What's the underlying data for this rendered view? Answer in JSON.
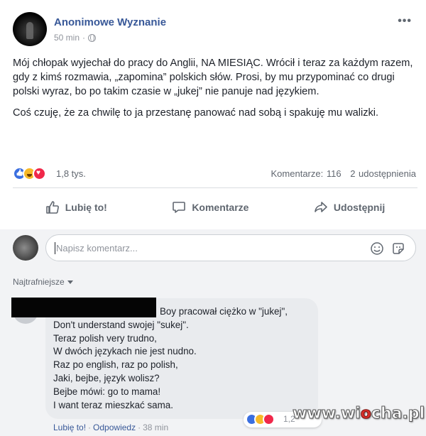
{
  "post": {
    "author": "Anonimowe Wyznanie",
    "time": "50 min",
    "privacy_icon": "globe-icon",
    "more_label": "•••",
    "paragraphs": [
      "Mój chłopak wyjechał do pracy do Anglii, NA MIESIĄC. Wrócił i teraz za każdym razem, gdy z kimś rozmawia, „zapomina” polskich słów. Prosi, by mu przypominać co drugi polski wyraz, bo po takim czasie w „jukej” nie panuje nad językiem.",
      "Coś czuję, że za chwilę to ja przestanę panować nad sobą i spakuję mu walizki."
    ]
  },
  "reactions": {
    "icons": [
      "like-icon",
      "haha-icon",
      "love-icon"
    ],
    "count": "1,8 tys.",
    "comments": "Komentarze: 116",
    "shares": "2 udostępnienia"
  },
  "actions": {
    "like": "Lubię to!",
    "comment": "Komentarze",
    "share": "Udostępnij"
  },
  "composer": {
    "placeholder": "Napisz komentarz..."
  },
  "sort": {
    "label": "Najtrafniejsze"
  },
  "comment": {
    "lines": [
      "Boy pracował ciężko w \"jukej\",",
      "Don't understand swojej \"sukej\".",
      "Teraz polish very trudno,",
      "W dwóch językach nie jest nudno.",
      "Raz po english, raz po polish,",
      "Jaki, bejbe, język wolisz?",
      "Bejbe mówi: go to mama!",
      "I want teraz mieszkać sama."
    ],
    "reaction_count": "1,2",
    "like": "Lubię to!",
    "reply": "Odpowiedz",
    "time": "38 min"
  },
  "watermark": {
    "part1": "www.wi",
    "part2": "o",
    "part3": "cha.pl"
  },
  "colors": {
    "link": "#385898",
    "like": "#3b6fe0",
    "haha": "#f7b928",
    "love": "#f0284a"
  }
}
